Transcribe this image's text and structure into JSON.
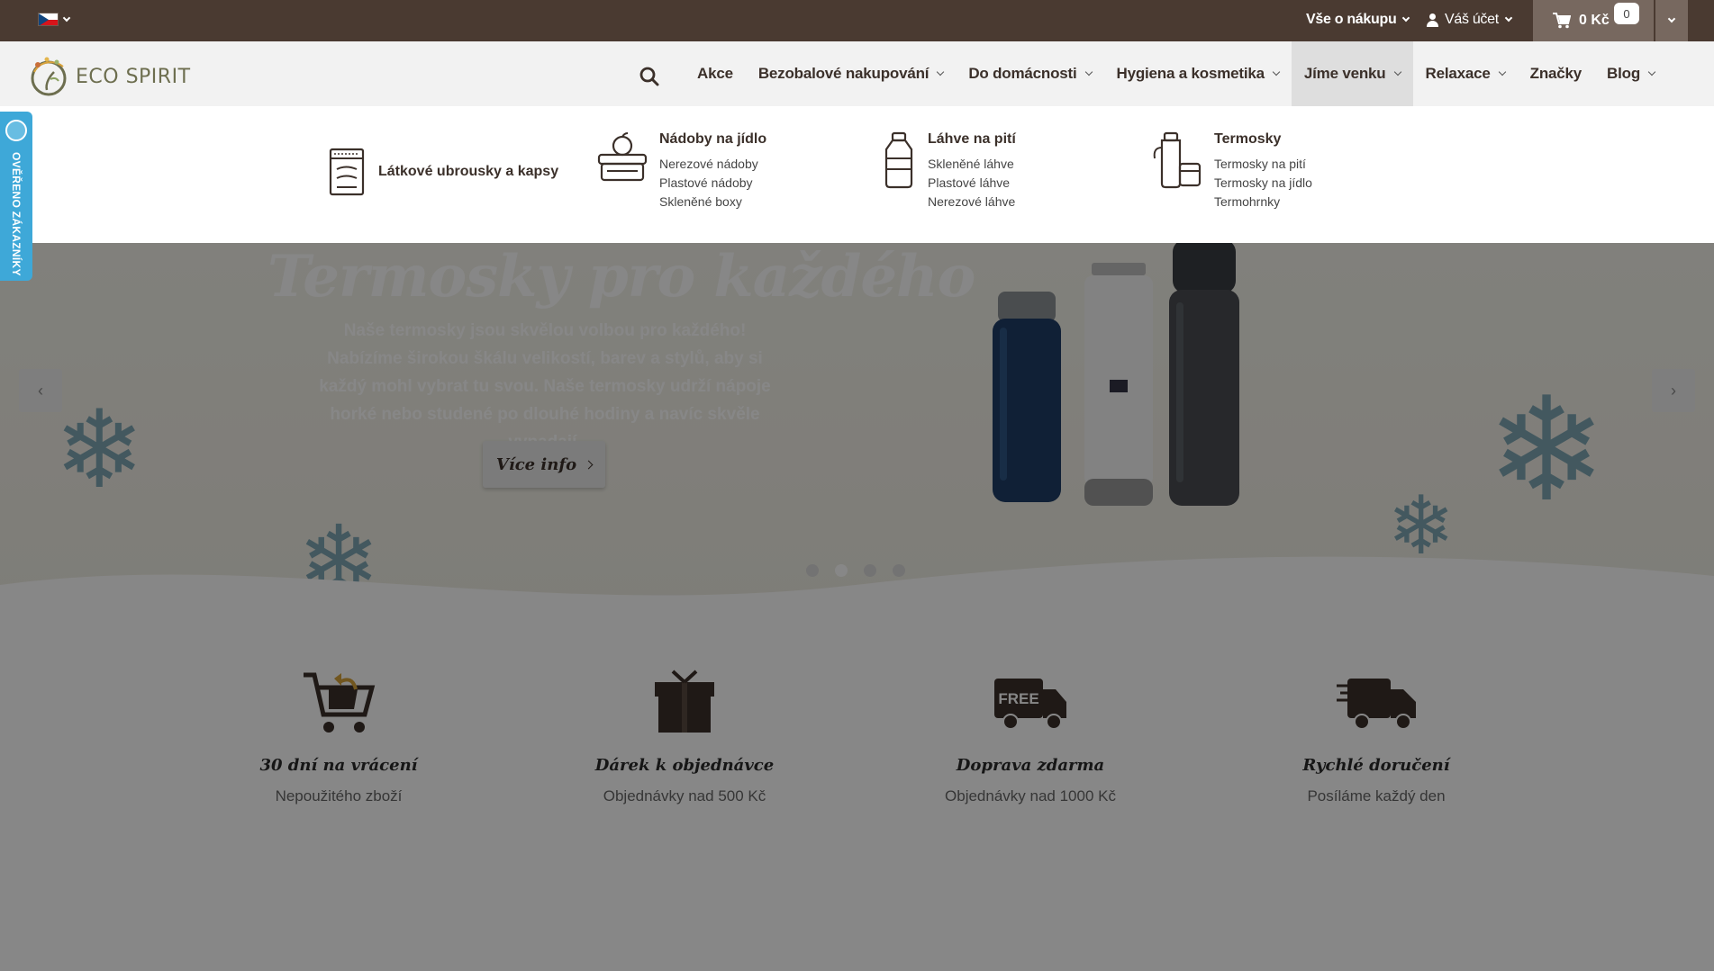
{
  "topbar": {
    "language": "cs",
    "shopping_info": "Vše o nákupu",
    "account": "Váš účet",
    "cart_total": "0 Kč",
    "cart_count": "0",
    "colors": {
      "background": "#4a3a31",
      "cart": "#77685f"
    }
  },
  "header": {
    "logo_text": "ECO SPIRIT",
    "search_icon": "search-icon",
    "nav": [
      {
        "label": "Akce"
      },
      {
        "label": "Bezobalové nakupování"
      },
      {
        "label": "Do domácnosti"
      },
      {
        "label": "Hygiena a kosmetika"
      },
      {
        "label": "Jíme venku"
      },
      {
        "label": "Relaxace"
      },
      {
        "label": "Značky"
      },
      {
        "label": "Blog"
      }
    ]
  },
  "mega_menu": {
    "columns": [
      {
        "title": "Látkové ubrousky a kapsy",
        "icon": "fabric-bag-icon",
        "links": []
      },
      {
        "title": "Nádoby na jídlo",
        "icon": "lunchbox-icon",
        "links": [
          "Nerezové nádoby",
          "Plastové nádoby",
          "Skleněné boxy"
        ]
      },
      {
        "title": "Láhve na pití",
        "icon": "bottle-icon",
        "links": [
          "Skleněné láhve",
          "Plastové láhve",
          "Nerezové láhve"
        ]
      },
      {
        "title": "Termosky",
        "icon": "thermos-icon",
        "links": [
          "Termosky na pití",
          "Termosky na jídlo",
          "Termohrnky"
        ]
      }
    ]
  },
  "side_badge": {
    "label": "OVĚŘENO ZÁKAZNÍKY",
    "color": "#3ea8d8"
  },
  "hero": {
    "title": "Termosky pro každého",
    "text": "Naše termosky jsou skvělou volbou pro každého! Nabízíme širokou škálu velikostí, barev a stylů, aby si každý mohl vybrat tu svou. Naše termosky udrží nápoje horké nebo studené po dlouhé hodiny a navíc skvěle vypadají.",
    "button": "Více info",
    "prev": "‹",
    "next": "›",
    "slide_count": 4,
    "active_slide": 2
  },
  "features": [
    {
      "icon": "cart-return-icon",
      "title": "30 dní na vrácení",
      "subtitle": "Nepoužitého zboží"
    },
    {
      "icon": "gift-icon",
      "title": "Dárek k objednávce",
      "subtitle": "Objednávky nad 500 Kč"
    },
    {
      "icon": "free-delivery-truck-icon",
      "title": "Doprava zdarma",
      "subtitle": "Objednávky nad 1000 Kč",
      "badge": "FREE"
    },
    {
      "icon": "fast-delivery-truck-icon",
      "title": "Rychlé doručení",
      "subtitle": "Posíláme každý den"
    }
  ]
}
